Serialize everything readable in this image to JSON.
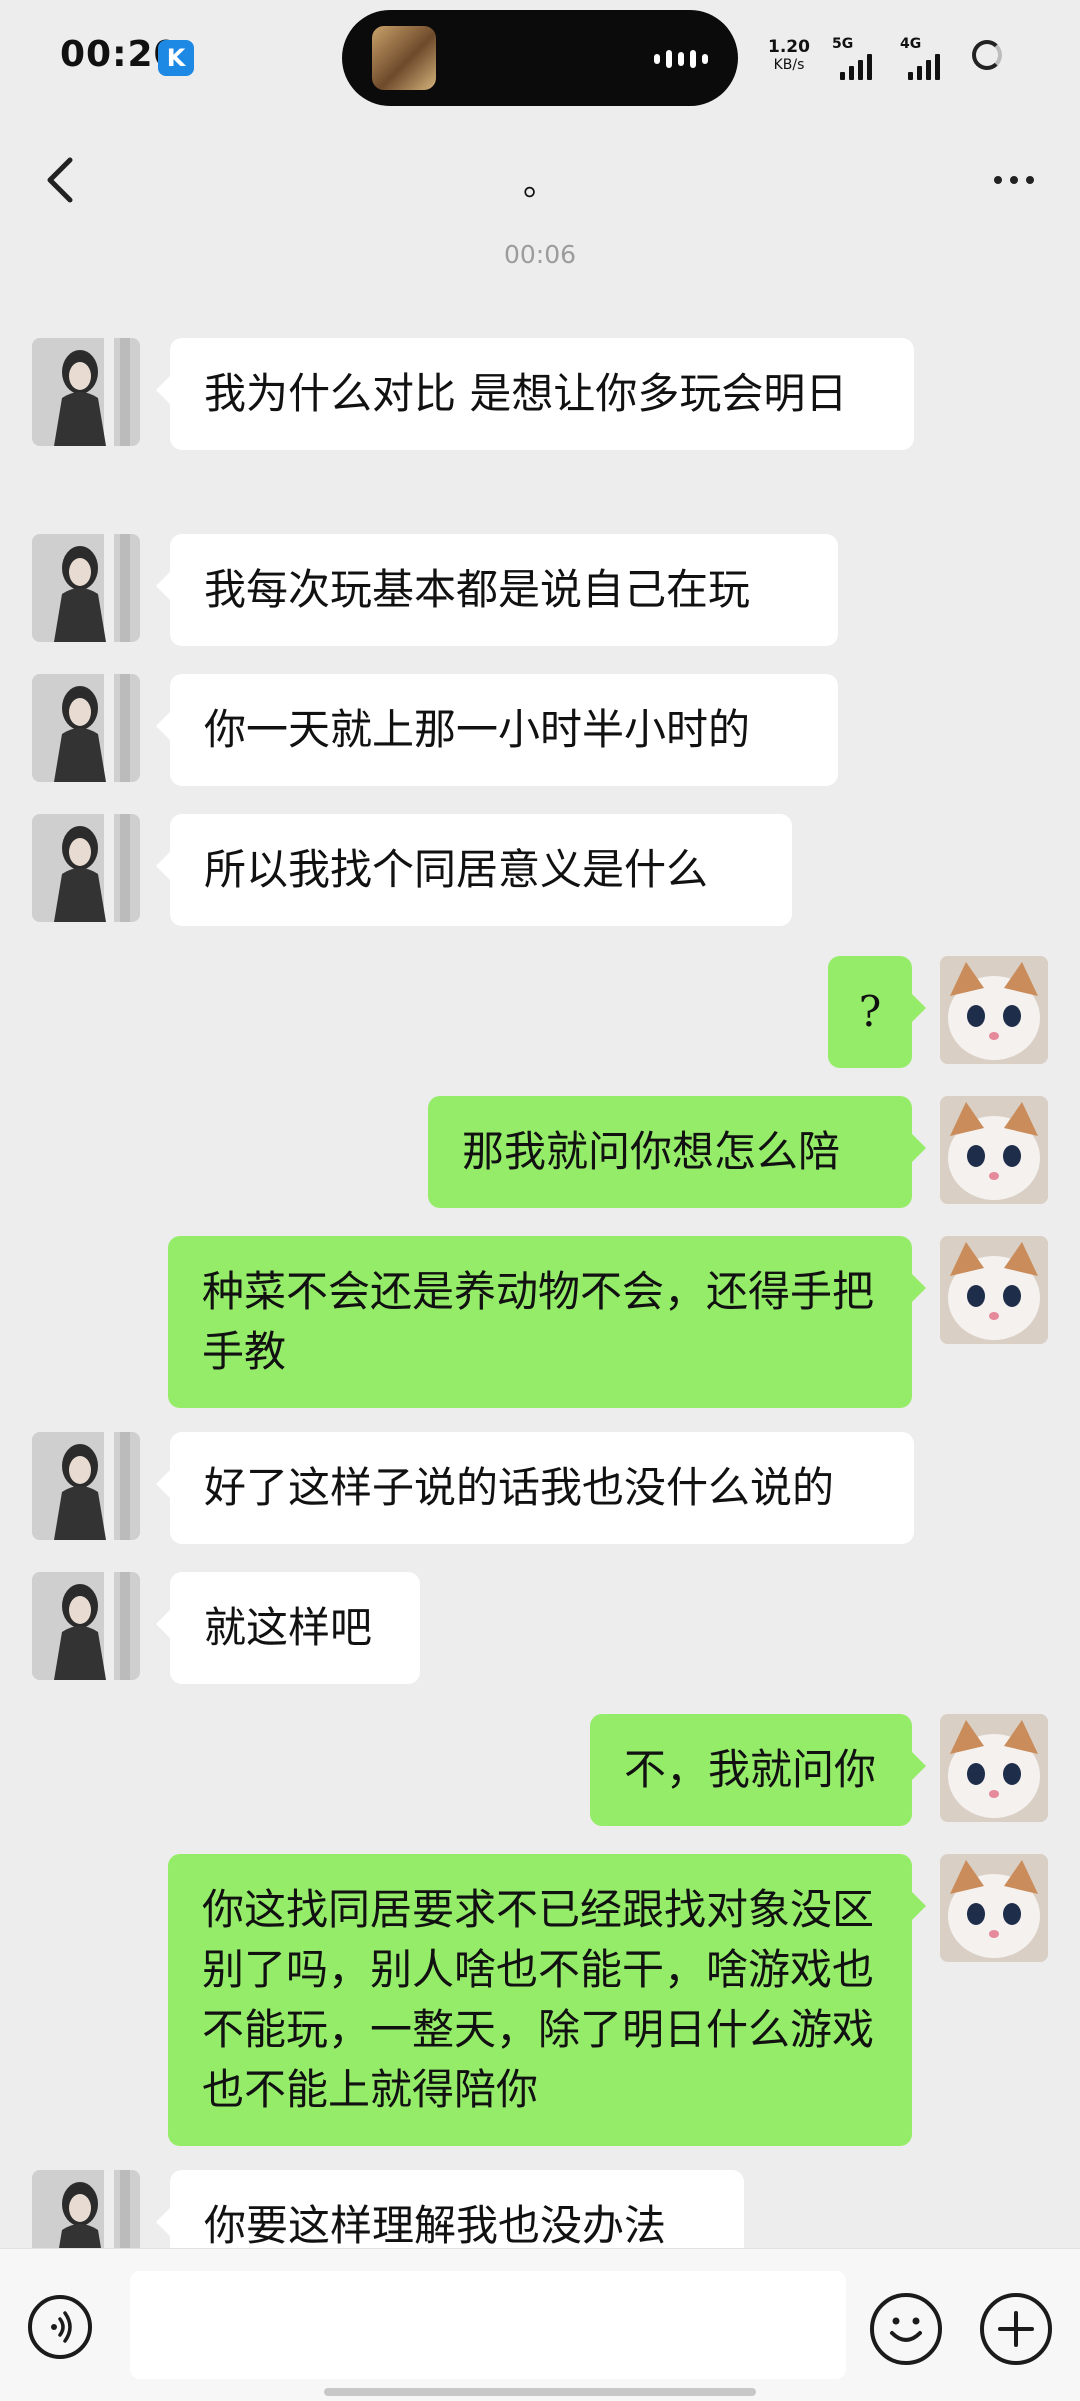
{
  "status_bar": {
    "time": "00:20",
    "app_badge": "K",
    "net_speed_value": "1.20",
    "net_speed_unit": "KB/s",
    "signal_1_label": "5G",
    "signal_2_label": "4G"
  },
  "header": {
    "title": "。"
  },
  "timestamp": "00:06",
  "messages": [
    {
      "side": "in",
      "text": "我为什么对比  是想让你多玩会明日"
    },
    {
      "side": "in",
      "text": "我每次玩基本都是说自己在玩"
    },
    {
      "side": "in",
      "text": "你一天就上那一小时半小时的"
    },
    {
      "side": "in",
      "text": "所以我找个同居意义是什么"
    },
    {
      "side": "out",
      "text": "?"
    },
    {
      "side": "out",
      "text": "那我就问你想怎么陪"
    },
    {
      "side": "out",
      "text": "种菜不会还是养动物不会，还得手把手教"
    },
    {
      "side": "in",
      "text": "好了这样子说的话我也没什么说的"
    },
    {
      "side": "in",
      "text": "就这样吧"
    },
    {
      "side": "out",
      "text": "不，我就问你"
    },
    {
      "side": "out",
      "text": "你这找同居要求不已经跟找对象没区别了吗，别人啥也不能干，啥游戏也不能玩，一整天，除了明日什么游戏也不能上就得陪你"
    },
    {
      "side": "in",
      "text": "你要这样理解我也没办法"
    }
  ],
  "input_bar": {
    "text_value": "",
    "icons": [
      "voice-icon",
      "emoji-icon",
      "plus-icon"
    ]
  },
  "colors": {
    "outgoing_bubble": "#95ec69",
    "incoming_bubble": "#ffffff",
    "background": "#ededed"
  }
}
